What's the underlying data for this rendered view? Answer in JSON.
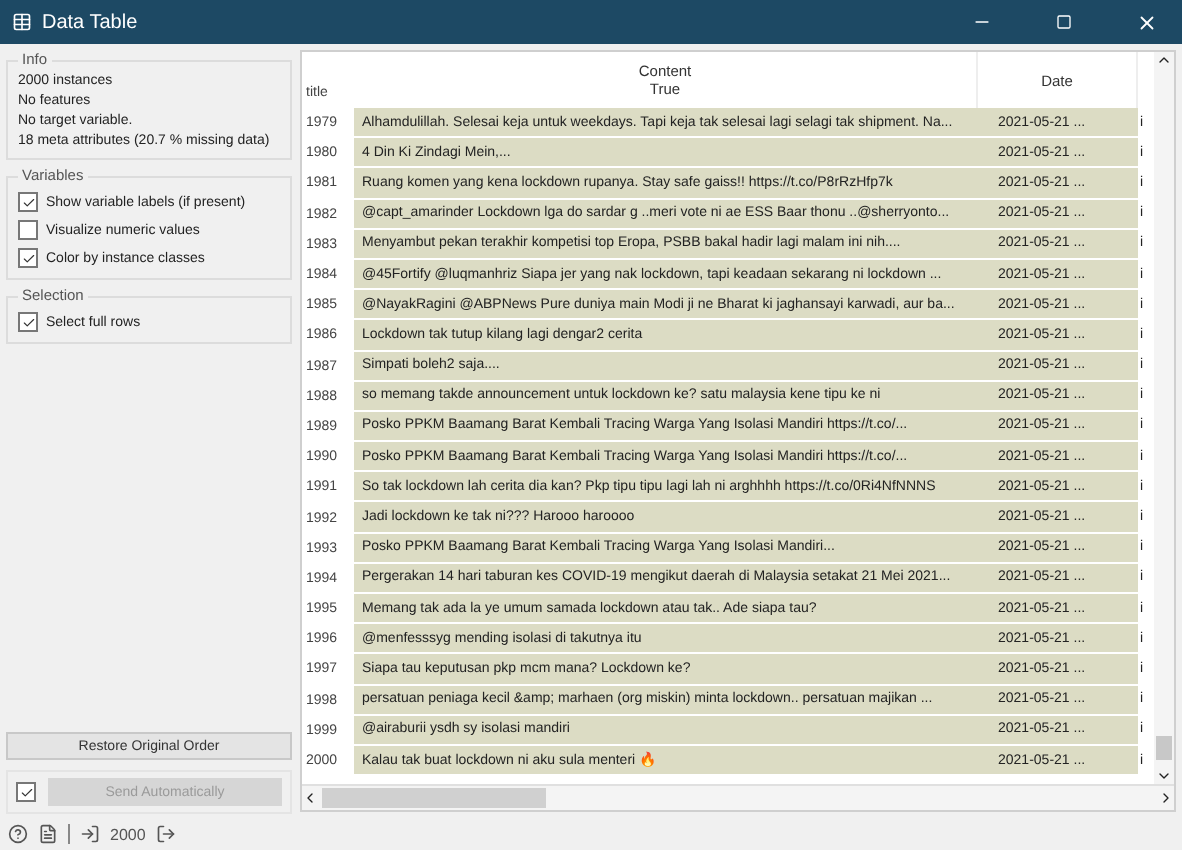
{
  "window": {
    "title": "Data Table"
  },
  "info": {
    "title": "Info",
    "lines": [
      "2000 instances",
      "No features",
      "No target variable.",
      "18 meta attributes (20.7 % missing data)"
    ]
  },
  "variables": {
    "title": "Variables",
    "options": [
      {
        "label": "Show variable labels (if present)",
        "checked": true
      },
      {
        "label": "Visualize numeric values",
        "checked": false
      },
      {
        "label": "Color by instance classes",
        "checked": true
      }
    ]
  },
  "selection": {
    "title": "Selection",
    "options": [
      {
        "label": "Select full rows",
        "checked": true
      }
    ]
  },
  "restore_button": "Restore Original Order",
  "send": {
    "checked": true,
    "label": "Send Automatically",
    "disabled": true
  },
  "table": {
    "row_header_title": "title",
    "columns": [
      {
        "label": "Content",
        "sublabel": "True"
      },
      {
        "label": "Date"
      }
    ],
    "rows": [
      {
        "index": "1979",
        "content": "Alhamdulillah. Selesai keja untuk weekdays. Tapi keja tak selesai lagi selagi tak shipment. Na...",
        "date": "2021-05-21 ...",
        "column_3": "i"
      },
      {
        "index": "1980",
        "content": "4 Din Ki Zindagi Mein,...",
        "date": "2021-05-21 ...",
        "column_3": "i"
      },
      {
        "index": "1981",
        "content": "Ruang komen yang kena lockdown rupanya. Stay safe gaiss!! https://t.co/P8rRzHfp7k",
        "date": "2021-05-21 ...",
        "column_3": "i"
      },
      {
        "index": "1982",
        "content": "@capt_amarinder Lockdown lga do sardar g ..meri vote ni ae ESS Baar thonu ..@sherryonto...",
        "date": "2021-05-21 ...",
        "column_3": "i"
      },
      {
        "index": "1983",
        "content": "Menyambut pekan terakhir kompetisi top Eropa, PSBB bakal hadir lagi malam ini nih....",
        "date": "2021-05-21 ...",
        "column_3": "i"
      },
      {
        "index": "1984",
        "content": "@45Fortify @luqmanhriz Siapa jer yang nak lockdown, tapi keadaan sekarang ni lockdown ...",
        "date": "2021-05-21 ...",
        "column_3": "i"
      },
      {
        "index": "1985",
        "content": "@NayakRagini @ABPNews Pure duniya main Modi ji ne Bharat ki jaghansayi karwadi, aur ba...",
        "date": "2021-05-21 ...",
        "column_3": "i"
      },
      {
        "index": "1986",
        "content": "Lockdown tak tutup kilang lagi dengar2 cerita",
        "date": "2021-05-21 ...",
        "column_3": "i"
      },
      {
        "index": "1987",
        "content": "Simpati boleh2 saja....",
        "date": "2021-05-21 ...",
        "column_3": "i"
      },
      {
        "index": "1988",
        "content": "so memang takde announcement untuk lockdown ke? satu malaysia kene tipu ke ni",
        "date": "2021-05-21 ...",
        "column_3": "i"
      },
      {
        "index": "1989",
        "content": "Posko PPKM Baamang Barat Kembali Tracing Warga Yang Isolasi Mandiri https://t.co/...",
        "date": "2021-05-21 ...",
        "column_3": "i"
      },
      {
        "index": "1990",
        "content": "Posko PPKM Baamang Barat Kembali Tracing Warga Yang Isolasi Mandiri https://t.co/...",
        "date": "2021-05-21 ...",
        "column_3": "i"
      },
      {
        "index": "1991",
        "content": "So tak lockdown lah cerita dia kan? Pkp tipu tipu lagi lah ni arghhhh https://t.co/0Ri4NfNNNS",
        "date": "2021-05-21 ...",
        "column_3": "i"
      },
      {
        "index": "1992",
        "content": "Jadi lockdown ke tak ni??? Harooo haroooo",
        "date": "2021-05-21 ...",
        "column_3": "i"
      },
      {
        "index": "1993",
        "content": "Posko PPKM Baamang Barat Kembali Tracing Warga Yang Isolasi Mandiri...",
        "date": "2021-05-21 ...",
        "column_3": "i"
      },
      {
        "index": "1994",
        "content": "Pergerakan 14 hari taburan kes COVID-19 mengikut daerah di Malaysia setakat 21 Mei 2021...",
        "date": "2021-05-21 ...",
        "column_3": "i"
      },
      {
        "index": "1995",
        "content": "Memang tak ada la ye umum samada lockdown atau tak.. Ade siapa tau?",
        "date": "2021-05-21 ...",
        "column_3": "i"
      },
      {
        "index": "1996",
        "content": "@menfesssyg mending isolasi di takutnya itu",
        "date": "2021-05-21 ...",
        "column_3": "i"
      },
      {
        "index": "1997",
        "content": "Siapa tau keputusan pkp mcm mana? Lockdown ke?",
        "date": "2021-05-21 ...",
        "column_3": "i"
      },
      {
        "index": "1998",
        "content": "persatuan peniaga kecil &amp; marhaen (org miskin) minta lockdown.. persatuan majikan ...",
        "date": "2021-05-21 ...",
        "column_3": "i"
      },
      {
        "index": "1999",
        "content": "@airaburii ysdh sy isolasi mandiri",
        "date": "2021-05-21 ...",
        "column_3": "i"
      },
      {
        "index": "2000",
        "content": "Kalau tak buat lockdown ni aku sula menteri 🔥",
        "date": "2021-05-21 ...",
        "column_3": "i"
      }
    ]
  },
  "status_bar": {
    "count": "2000"
  }
}
